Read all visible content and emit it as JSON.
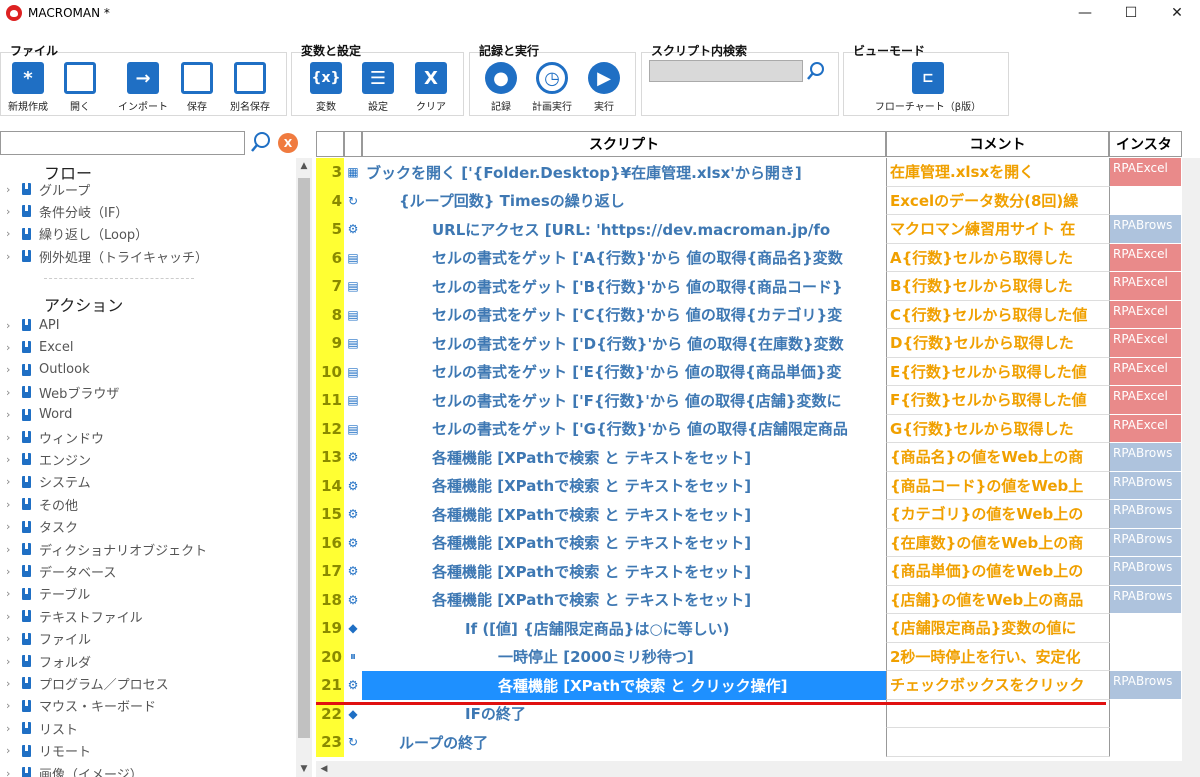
{
  "window": {
    "title": "MACROMAN *",
    "minimize": "—",
    "maximize": "☐",
    "close": "✕"
  },
  "ribbon": {
    "file": {
      "title": "ファイル",
      "new": "新規作成",
      "open": "開く",
      "import": "インポート",
      "save": "保存",
      "save_as": "別名保存"
    },
    "vars": {
      "title": "変数と設定",
      "variables": "変数",
      "settings": "設定",
      "clear": "クリア"
    },
    "record": {
      "title": "記録と実行",
      "record": "記録",
      "schedule": "計画実行",
      "run": "実行"
    },
    "search": {
      "title": "スクリプト内検索"
    },
    "view": {
      "title": "ビューモード",
      "flowchart": "フローチャート（β版）"
    }
  },
  "left": {
    "flow_header": "フロー",
    "flow_items": [
      "グループ",
      "条件分岐（IF）",
      "繰り返し（Loop）",
      "例外処理（トライキャッチ）"
    ],
    "action_header": "アクション",
    "action_items": [
      "API",
      "Excel",
      "Outlook",
      "Webブラウザ",
      "Word",
      "ウィンドウ",
      "エンジン",
      "システム",
      "その他",
      "タスク",
      "ディクショナリオブジェクト",
      "データベース",
      "テーブル",
      "テキストファイル",
      "ファイル",
      "フォルダ",
      "プログラム／プロセス",
      "マウス・キーボード",
      "リスト",
      "リモート",
      "画像（イメージ）"
    ],
    "clear_label": "X"
  },
  "grid": {
    "headers": {
      "script": "スクリプト",
      "comment": "コメント",
      "instance": "インスタ"
    },
    "rows": [
      {
        "num": "3",
        "icon": "▦",
        "script": "ブックを開く ['{Folder.Desktop}¥在庫管理.xlsx'から開き]",
        "comment": "在庫管理.xlsxを開く",
        "inst": "RPAExcel",
        "inst_type": "excel",
        "indent": 0
      },
      {
        "num": "4",
        "icon": "↻",
        "script": "{ループ回数} Timesの繰り返し",
        "comment": "Excelのデータ数分(8回)繰",
        "inst": "",
        "inst_type": "",
        "indent": 1
      },
      {
        "num": "5",
        "icon": "⚙",
        "script": "URLにアクセス [URL: 'https://dev.macroman.jp/fo",
        "comment": "マクロマン練習用サイト 在",
        "inst": "RPABrows",
        "inst_type": "browser",
        "indent": 2
      },
      {
        "num": "6",
        "icon": "▤",
        "script": "セルの書式をゲット ['A{行数}'から 値の取得{商品名}変数",
        "comment": "A{行数}セルから取得した",
        "inst": "RPAExcel",
        "inst_type": "excel",
        "indent": 2
      },
      {
        "num": "7",
        "icon": "▤",
        "script": "セルの書式をゲット ['B{行数}'から 値の取得{商品コード}",
        "comment": "B{行数}セルから取得した",
        "inst": "RPAExcel",
        "inst_type": "excel",
        "indent": 2
      },
      {
        "num": "8",
        "icon": "▤",
        "script": "セルの書式をゲット ['C{行数}'から 値の取得{カテゴリ}変",
        "comment": "C{行数}セルから取得した値",
        "inst": "RPAExcel",
        "inst_type": "excel",
        "indent": 2
      },
      {
        "num": "9",
        "icon": "▤",
        "script": "セルの書式をゲット ['D{行数}'から 値の取得{在庫数}変数",
        "comment": "D{行数}セルから取得した",
        "inst": "RPAExcel",
        "inst_type": "excel",
        "indent": 2
      },
      {
        "num": "10",
        "icon": "▤",
        "script": "セルの書式をゲット ['E{行数}'から 値の取得{商品単価}変",
        "comment": "E{行数}セルから取得した値",
        "inst": "RPAExcel",
        "inst_type": "excel",
        "indent": 2
      },
      {
        "num": "11",
        "icon": "▤",
        "script": "セルの書式をゲット ['F{行数}'から 値の取得{店舗}変数に",
        "comment": "F{行数}セルから取得した値",
        "inst": "RPAExcel",
        "inst_type": "excel",
        "indent": 2
      },
      {
        "num": "12",
        "icon": "▤",
        "script": "セルの書式をゲット ['G{行数}'から 値の取得{店舗限定商品",
        "comment": "G{行数}セルから取得した",
        "inst": "RPAExcel",
        "inst_type": "excel",
        "indent": 2
      },
      {
        "num": "13",
        "icon": "⚙",
        "script": "各種機能 [XPathで検索 と テキストをセット]",
        "comment": "{商品名}の値をWeb上の商",
        "inst": "RPABrows",
        "inst_type": "browser",
        "indent": 2
      },
      {
        "num": "14",
        "icon": "⚙",
        "script": "各種機能 [XPathで検索 と テキストをセット]",
        "comment": "{商品コード}の値をWeb上",
        "inst": "RPABrows",
        "inst_type": "browser",
        "indent": 2
      },
      {
        "num": "15",
        "icon": "⚙",
        "script": "各種機能 [XPathで検索 と テキストをセット]",
        "comment": "{カテゴリ}の値をWeb上の",
        "inst": "RPABrows",
        "inst_type": "browser",
        "indent": 2
      },
      {
        "num": "16",
        "icon": "⚙",
        "script": "各種機能 [XPathで検索 と テキストをセット]",
        "comment": "{在庫数}の値をWeb上の商",
        "inst": "RPABrows",
        "inst_type": "browser",
        "indent": 2
      },
      {
        "num": "17",
        "icon": "⚙",
        "script": "各種機能 [XPathで検索 と テキストをセット]",
        "comment": "{商品単価}の値をWeb上の",
        "inst": "RPABrows",
        "inst_type": "browser",
        "indent": 2
      },
      {
        "num": "18",
        "icon": "⚙",
        "script": "各種機能 [XPathで検索 と テキストをセット]",
        "comment": "{店舗}の値をWeb上の商品",
        "inst": "RPABrows",
        "inst_type": "browser",
        "indent": 2
      },
      {
        "num": "19",
        "icon": "◆",
        "script": "If ([値] {店舗限定商品}は○に等しい)",
        "comment": "{店舗限定商品}変数の値に",
        "inst": "",
        "inst_type": "",
        "indent": 3
      },
      {
        "num": "20",
        "icon": "⏸",
        "script": "一時停止 [2000ミリ秒待つ]",
        "comment": "2秒一時停止を行い、安定化",
        "inst": "",
        "inst_type": "",
        "indent": 4
      },
      {
        "num": "21",
        "icon": "⚙",
        "script": "各種機能 [XPathで検索 と クリック操作]",
        "comment": "チェックボックスをクリック",
        "inst": "RPABrows",
        "inst_type": "browser",
        "indent": 4,
        "selected": true
      },
      {
        "num": "22",
        "icon": "◆",
        "script": "IFの終了",
        "comment": "",
        "inst": "",
        "inst_type": "",
        "indent": 3
      },
      {
        "num": "23",
        "icon": "↻",
        "script": "ループの終了",
        "comment": "",
        "inst": "",
        "inst_type": "",
        "indent": 1
      }
    ]
  }
}
